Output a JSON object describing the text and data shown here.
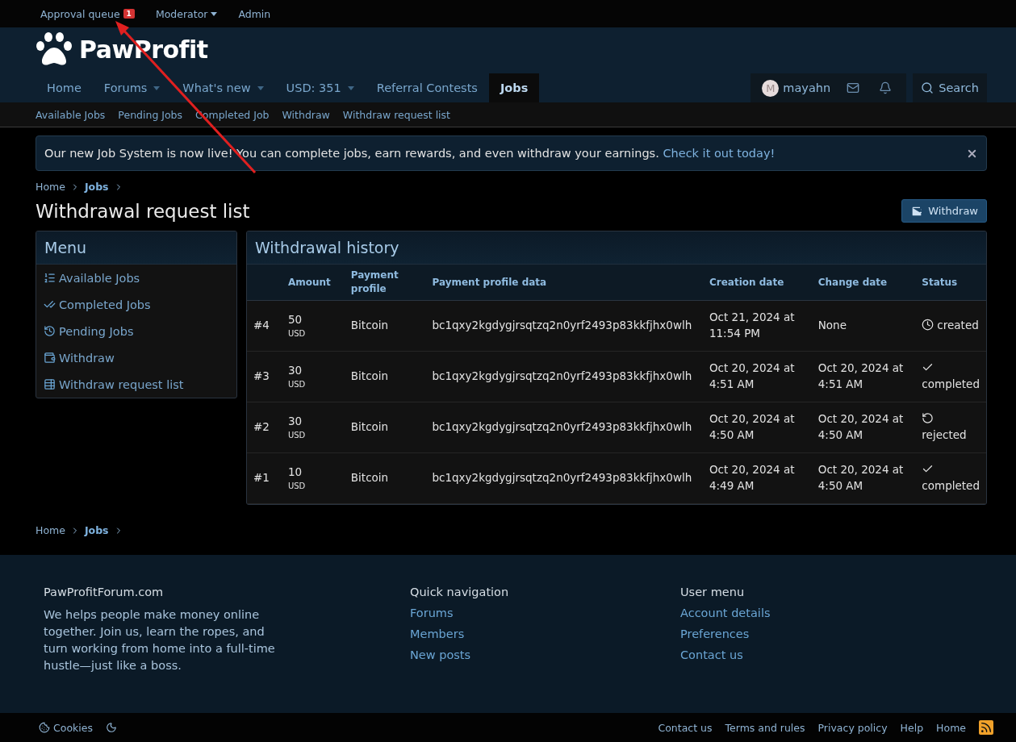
{
  "staff_bar": [
    {
      "label": "Approval queue",
      "badge": "1",
      "has_menu": false
    },
    {
      "label": "Moderator",
      "has_menu": true
    },
    {
      "label": "Admin",
      "has_menu": false
    }
  ],
  "logo": {
    "text": "PawProfit"
  },
  "nav": [
    {
      "label": "Home",
      "has_menu": false,
      "selected": false
    },
    {
      "label": "Forums",
      "has_menu": true,
      "selected": false
    },
    {
      "label": "What's new",
      "has_menu": true,
      "selected": false
    },
    {
      "label": "USD: 351",
      "has_menu": true,
      "selected": false
    },
    {
      "label": "Referral Contests",
      "has_menu": false,
      "selected": false
    },
    {
      "label": "Jobs",
      "has_menu": false,
      "selected": true
    }
  ],
  "user": {
    "avatar_letter": "M",
    "name": "mayahn",
    "search": "Search"
  },
  "subnav": [
    "Available Jobs",
    "Pending Jobs",
    "Completed Job",
    "Withdraw",
    "Withdraw request list"
  ],
  "notice": {
    "text": "Our new Job System is now live! You can complete jobs, earn rewards, and even withdraw your earnings.",
    "link": "Check it out today!"
  },
  "breadcrumb": [
    {
      "label": "Home",
      "current": false
    },
    {
      "label": "Jobs",
      "current": true
    }
  ],
  "breadcrumb_bottom": [
    {
      "label": "Home",
      "current": false
    },
    {
      "label": "Jobs",
      "current": true
    }
  ],
  "title": "Withdrawal request list",
  "action_button": "Withdraw",
  "menu": {
    "title": "Menu",
    "items": [
      {
        "label": "Available Jobs",
        "kind": "list"
      },
      {
        "label": "Completed Jobs",
        "kind": "check"
      },
      {
        "label": "Pending Jobs",
        "kind": "history"
      },
      {
        "label": "Withdraw",
        "kind": "wallet"
      },
      {
        "label": "Withdraw request list",
        "kind": "table"
      }
    ]
  },
  "table": {
    "title": "Withdrawal history",
    "columns": [
      "Amount",
      "Payment profile",
      "Payment profile data",
      "Creation date",
      "Change date",
      "Status"
    ],
    "rows": [
      {
        "id": "#4",
        "amount": "50",
        "currency": "USD",
        "profile": "Bitcoin",
        "data": "bc1qxy2kgdygjrsqtzq2n0yrf2493p83kkfjhx0wlh",
        "created": "Oct 21, 2024 at 11:54 PM",
        "changed": "None",
        "status": "created",
        "kind": "created"
      },
      {
        "id": "#3",
        "amount": "30",
        "currency": "USD",
        "profile": "Bitcoin",
        "data": "bc1qxy2kgdygjrsqtzq2n0yrf2493p83kkfjhx0wlh",
        "created": "Oct 20, 2024 at 4:51 AM",
        "changed": "Oct 20, 2024 at 4:51 AM",
        "status": "completed",
        "kind": "completed"
      },
      {
        "id": "#2",
        "amount": "30",
        "currency": "USD",
        "profile": "Bitcoin",
        "data": "bc1qxy2kgdygjrsqtzq2n0yrf2493p83kkfjhx0wlh",
        "created": "Oct 20, 2024 at 4:50 AM",
        "changed": "Oct 20, 2024 at 4:50 AM",
        "status": "rejected",
        "kind": "rejected"
      },
      {
        "id": "#1",
        "amount": "10",
        "currency": "USD",
        "profile": "Bitcoin",
        "data": "bc1qxy2kgdygjrsqtzq2n0yrf2493p83kkfjhx0wlh",
        "created": "Oct 20, 2024 at 4:49 AM",
        "changed": "Oct 20, 2024 at 4:50 AM",
        "status": "completed",
        "kind": "completed"
      }
    ]
  },
  "footer": {
    "site": "PawProfitForum.com",
    "about": "We helps people make money online together. Join us, learn the ropes, and turn working from home into a full-time hustle—just like a boss.",
    "columns": [
      {
        "title": "Quick navigation",
        "links": [
          "Forums",
          "Members",
          "New posts"
        ]
      },
      {
        "title": "User menu",
        "links": [
          "Account details",
          "Preferences",
          "Contact us"
        ]
      }
    ]
  },
  "bottom_bar": {
    "cookies": "Cookies",
    "links": [
      "Contact us",
      "Terms and rules",
      "Privacy policy",
      "Help",
      "Home"
    ]
  }
}
